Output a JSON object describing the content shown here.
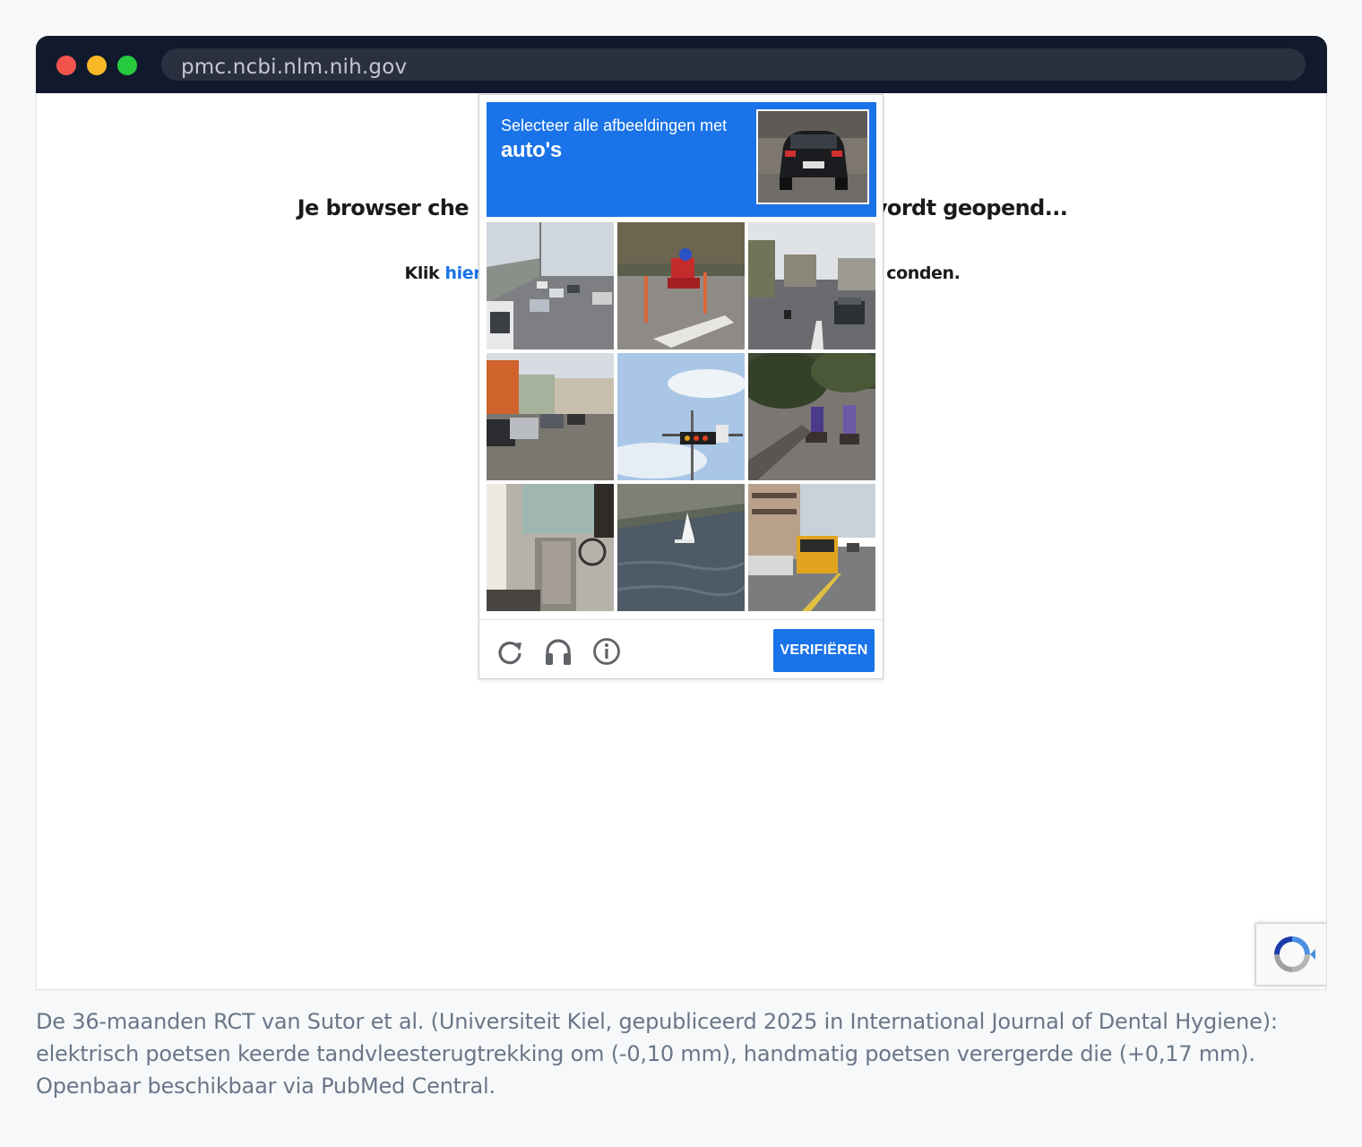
{
  "browser": {
    "url": "pmc.ncbi.nlm.nih.gov"
  },
  "page": {
    "checking_text": "Je browser checkt... Het artikel wordt geopend...",
    "sub_prefix": "Klik ",
    "sub_link": "hier",
    "sub_suffix": " als het niet binnen enkele seconden.",
    "visible_checking_left": "Je browser che",
    "visible_checking_right": "vordt geopend...",
    "visible_sub_left": "Klik ",
    "visible_sub_link": "hier",
    "visible_sub_right": "conden."
  },
  "captcha": {
    "instruction": "Selecteer alle afbeeldingen met",
    "target": "auto's",
    "verify_label": "VERIFIËREN",
    "tiles": [
      {
        "scene": "highway-traffic"
      },
      {
        "scene": "scooter-rider"
      },
      {
        "scene": "street-with-car"
      },
      {
        "scene": "parked-cars-street"
      },
      {
        "scene": "traffic-light-sky"
      },
      {
        "scene": "motorbikes-trees"
      },
      {
        "scene": "sidewalk-bicycle"
      },
      {
        "scene": "sailboat-water"
      },
      {
        "scene": "bus-on-road"
      }
    ],
    "controls": [
      "reload-icon",
      "audio-icon",
      "info-icon"
    ]
  },
  "caption": "De 36-maanden RCT van Sutor et al. (Universiteit Kiel, gepubliceerd 2025 in International Journal of Dental Hygiene): elektrisch poetsen keerde tandvleesterugtrekking om (-0,10 mm), handmatig poetsen verergerde die (+0,17 mm). Openbaar beschikbaar via PubMed Central.",
  "colors": {
    "accent": "#1a73e8",
    "titlebar": "#111a2c"
  }
}
